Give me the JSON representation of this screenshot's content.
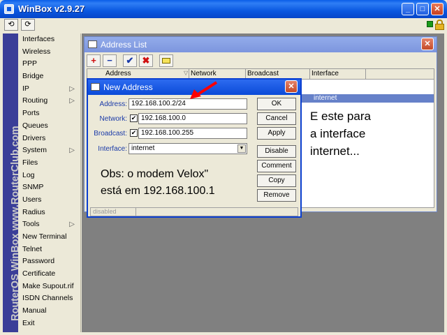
{
  "window": {
    "title": "WinBox v2.9.27",
    "minimize": "_",
    "maximize": "□",
    "close": "✕"
  },
  "toolbar": {
    "undo": "⟲",
    "redo": "⟳"
  },
  "brand": {
    "text": "RouterOS WinBox   www.RouterClub.com"
  },
  "sidebar": {
    "items": [
      {
        "label": "Interfaces"
      },
      {
        "label": "Wireless"
      },
      {
        "label": "PPP"
      },
      {
        "label": "Bridge"
      },
      {
        "label": "IP",
        "submenu": true
      },
      {
        "label": "Routing",
        "submenu": true
      },
      {
        "label": "Ports"
      },
      {
        "label": "Queues"
      },
      {
        "label": "Drivers"
      },
      {
        "label": "System",
        "submenu": true
      },
      {
        "label": "Files"
      },
      {
        "label": "Log"
      },
      {
        "label": "SNMP"
      },
      {
        "label": "Users"
      },
      {
        "label": "Radius"
      },
      {
        "label": "Tools",
        "submenu": true
      },
      {
        "label": "New Terminal"
      },
      {
        "label": "Telnet"
      },
      {
        "label": "Password"
      },
      {
        "label": "Certificate"
      },
      {
        "label": "Make Supout.rif"
      },
      {
        "label": "ISDN Channels"
      },
      {
        "label": "Manual"
      },
      {
        "label": "Exit"
      }
    ],
    "submenu_glyph": "▷"
  },
  "address_list": {
    "title": "Address List",
    "close": "✕",
    "toolbar": {
      "add": "+",
      "remove": "−",
      "enable": "✔",
      "disable": "✖",
      "comment": ""
    },
    "columns": [
      "Address",
      "Network",
      "Broadcast",
      "Interface"
    ],
    "selected_row": {
      "interface": "internet"
    },
    "note": [
      "E este para",
      "a interface",
      "internet..."
    ]
  },
  "new_address": {
    "title": "New Address",
    "close": "✕",
    "fields": {
      "address": {
        "label": "Address:",
        "value": "192.168.100.2/24"
      },
      "network": {
        "label": "Network:",
        "value": "192.168.100.0",
        "checked": true
      },
      "broadcast": {
        "label": "Broadcast:",
        "value": "192.168.100.255",
        "checked": true
      },
      "interface": {
        "label": "Interface:",
        "value": "internet"
      }
    },
    "check_mark": "✔",
    "dropdown_arrow": "▼",
    "buttons": {
      "ok": "OK",
      "cancel": "Cancel",
      "apply": "Apply",
      "disable": "Disable",
      "comment": "Comment",
      "copy": "Copy",
      "remove": "Remove"
    },
    "note": [
      "Obs: o modem Velox\"",
      "está em 192.168.100.1"
    ],
    "status": "disabled"
  },
  "colors": {
    "arrow": "#ff0000",
    "title_blue": "#0a58e0",
    "selection": "#6681c9",
    "brand_strip": "#3a3e98"
  }
}
